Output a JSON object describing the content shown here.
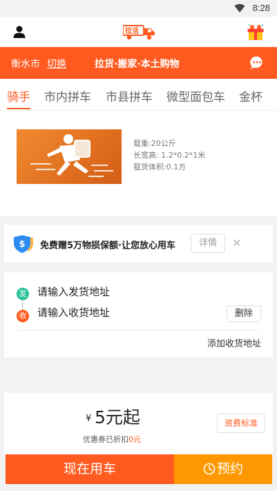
{
  "status_bar": {
    "time": "8:28",
    "wifi_icon": "wifi-icon"
  },
  "app_bar": {
    "user_icon": "user-icon",
    "logo_icon": "truck-logo-icon",
    "logo_text": "拉活",
    "gift_icon": "gift-icon"
  },
  "header": {
    "city": "衡水市",
    "switch_label": "切换",
    "slogan": "拉货·搬家·本土购物",
    "message_icon": "message-icon"
  },
  "colors": {
    "accent": "#ff5a1f",
    "reserve": "#ff9800",
    "send_dot": "#27c29a"
  },
  "tabs": [
    {
      "label": "骑手",
      "active": true
    },
    {
      "label": "市内拼车"
    },
    {
      "label": "市县拼车"
    },
    {
      "label": "微型面包车"
    },
    {
      "label": "金杯"
    }
  ],
  "vehicle": {
    "image_icon": "courier-runner-icon",
    "load": "载重:20公斤",
    "size": "长宽高: 1.2*0.2*1米",
    "volume": "载货体积:0.1方"
  },
  "insurance": {
    "shield_icon": "shield-dollar-icon",
    "text": "免费赠5万物损保额·让您放心用车",
    "detail_label": "详情",
    "close_label": "×"
  },
  "address": {
    "send_badge": "发",
    "recv_badge": "收",
    "send_placeholder": "请输入发货地址",
    "recv_placeholder": "请输入收货地址",
    "delete_label": "删除",
    "add_label": "添加收货地址"
  },
  "price": {
    "currency": "¥",
    "amount": "5元起",
    "note_prefix": "优惠券已折扣",
    "note_value": "0元",
    "standard_label": "资费标准"
  },
  "actions": {
    "now_label": "现在用车",
    "reserve_label": "预约",
    "clock_icon": "clock-icon"
  }
}
